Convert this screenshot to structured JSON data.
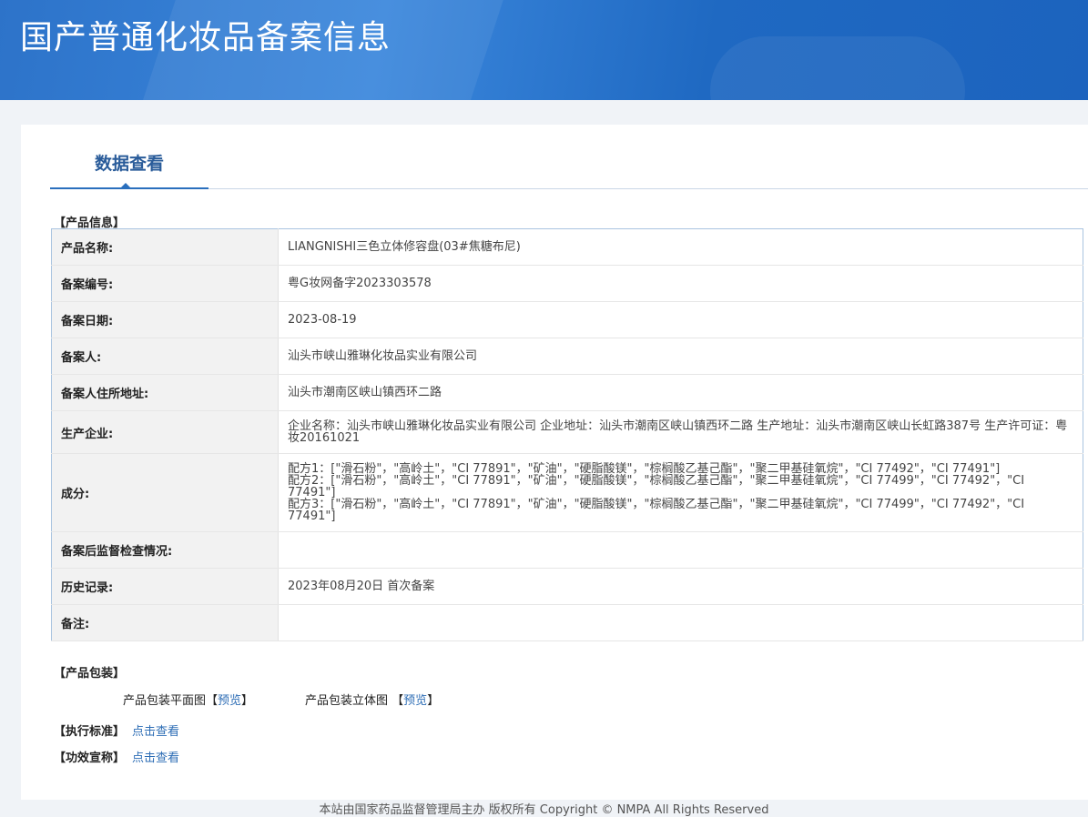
{
  "header": {
    "title": "国产普通化妆品备案信息"
  },
  "tabs": [
    {
      "label": "数据查看"
    }
  ],
  "product_info": {
    "section_title": "【产品信息】",
    "rows": [
      {
        "label": "产品名称:",
        "value": "LIANGNISHI三色立体修容盘(03#焦糖布尼)"
      },
      {
        "label": "备案编号:",
        "value": "粤G妆网备字2023303578"
      },
      {
        "label": "备案日期:",
        "value": "2023-08-19"
      },
      {
        "label": "备案人:",
        "value": "汕头市峡山雅琳化妆品实业有限公司"
      },
      {
        "label": "备案人住所地址:",
        "value": "汕头市潮南区峡山镇西环二路"
      },
      {
        "label": "生产企业:",
        "value": "企业名称：汕头市峡山雅琳化妆品实业有限公司 企业地址：汕头市潮南区峡山镇西环二路 生产地址：汕头市潮南区峡山长虹路387号 生产许可证：粤妆20161021"
      },
      {
        "label": "成分:",
        "lines": [
          "配方1：[\"滑石粉\"，\"高岭土\"，\"CI 77891\"，\"矿油\"，\"硬脂酸镁\"，\"棕榈酸乙基己酯\"，\"聚二甲基硅氧烷\"，\"CI 77492\"，\"CI 77491\"]",
          "配方2：[\"滑石粉\"，\"高岭土\"，\"CI 77891\"，\"矿油\"，\"硬脂酸镁\"，\"棕榈酸乙基己酯\"，\"聚二甲基硅氧烷\"，\"CI 77499\"，\"CI 77492\"，\"CI 77491\"]",
          "配方3：[\"滑石粉\"，\"高岭土\"，\"CI 77891\"，\"矿油\"，\"硬脂酸镁\"，\"棕榈酸乙基己酯\"，\"聚二甲基硅氧烷\"，\"CI 77499\"，\"CI 77492\"，\"CI 77491\"]"
        ]
      },
      {
        "label": "备案后监督检查情况:",
        "value": ""
      },
      {
        "label": "历史记录:",
        "value": "2023年08月20日 首次备案"
      },
      {
        "label": "备注:",
        "value": ""
      }
    ]
  },
  "packaging": {
    "section_title": "【产品包装】",
    "flat_label": "产品包装平面图",
    "three_d_label": "产品包装立体图",
    "bracket_open": "【",
    "bracket_close": "】",
    "preview_link": "预览"
  },
  "standard": {
    "label": "【执行标准】",
    "link": "点击查看"
  },
  "efficacy": {
    "label": "【功效宣称】",
    "link": "点击查看"
  },
  "footer": {
    "text": "本站由国家药品监督管理局主办 版权所有 Copyright © NMPA All Rights Reserved"
  },
  "colors": {
    "header_blue": "#2d73c9",
    "tab_accent": "#2a6fbd",
    "link": "#2d6db5"
  }
}
